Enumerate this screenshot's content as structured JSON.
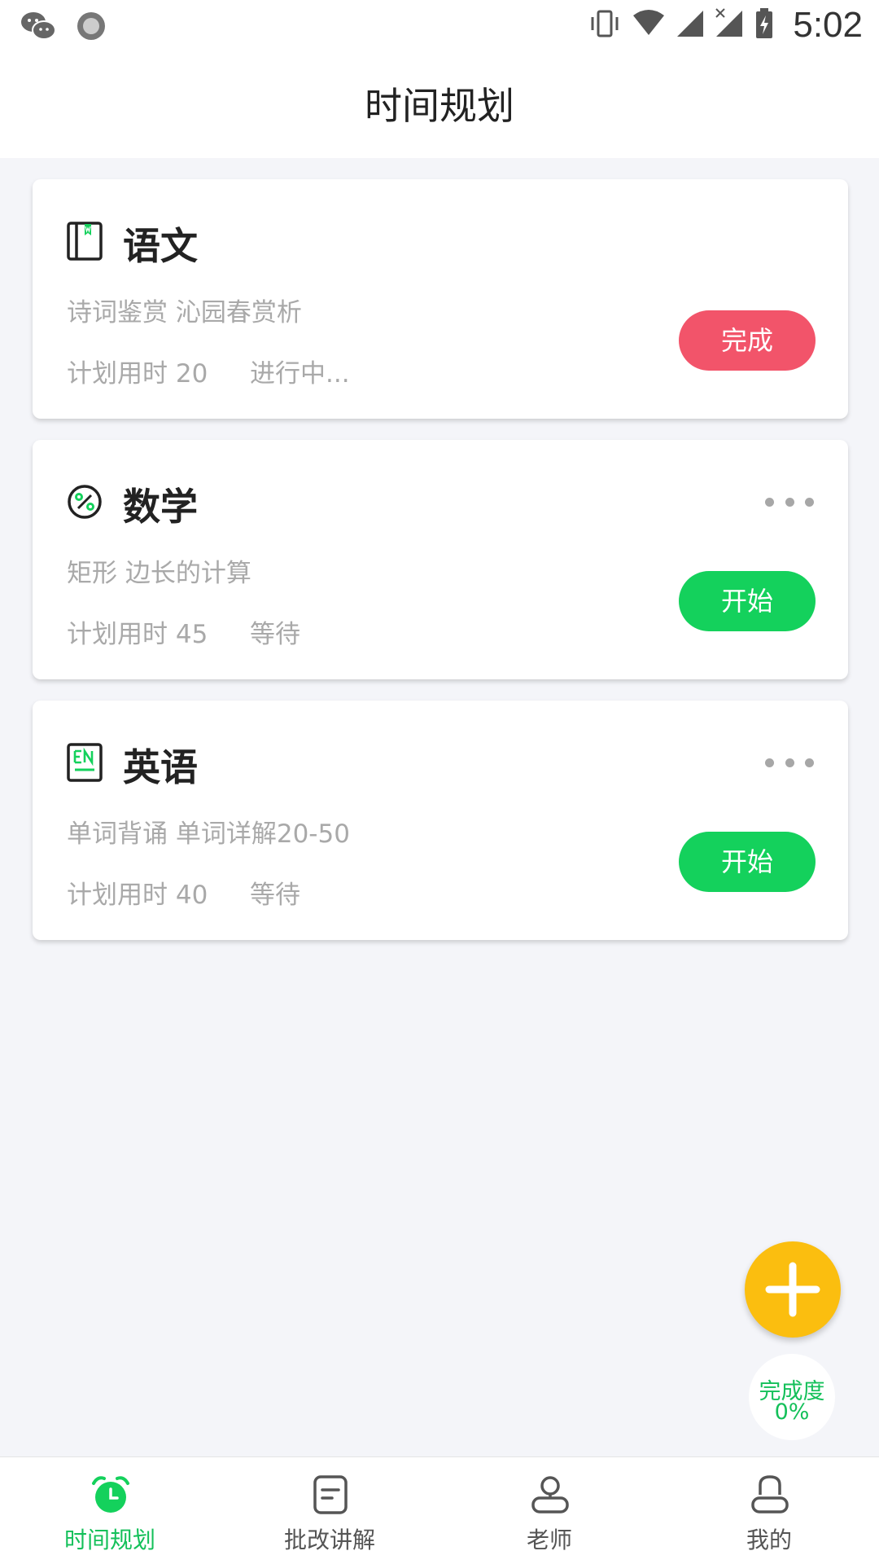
{
  "status_bar": {
    "time": "5:02"
  },
  "header": {
    "title": "时间规划"
  },
  "tasks": [
    {
      "subject": "语文",
      "desc": "诗词鉴赏 沁园春赏析",
      "plan": "计划用时 20",
      "state": "进行中...",
      "button": "完成",
      "icon": "book-icon",
      "show_more": false
    },
    {
      "subject": "数学",
      "desc": "矩形 边长的计算",
      "plan": "计划用时 45",
      "state": "等待",
      "button": "开始",
      "icon": "percent-icon",
      "show_more": true
    },
    {
      "subject": "英语",
      "desc": "单词背诵 单词详解20-50",
      "plan": "计划用时 40",
      "state": "等待",
      "button": "开始",
      "icon": "en-icon",
      "show_more": true
    }
  ],
  "completion": {
    "label": "完成度",
    "value": "0%"
  },
  "tabs": [
    {
      "label": "时间规划",
      "icon": "alarm-clock-icon",
      "active": true
    },
    {
      "label": "批改讲解",
      "icon": "document-icon",
      "active": false
    },
    {
      "label": "老师",
      "icon": "teacher-icon",
      "active": false
    },
    {
      "label": "我的",
      "icon": "profile-icon",
      "active": false
    }
  ],
  "colors": {
    "green": "#14d15c",
    "red": "#f2546a",
    "yellow": "#fbbe0f",
    "background": "#f4f5f9"
  }
}
